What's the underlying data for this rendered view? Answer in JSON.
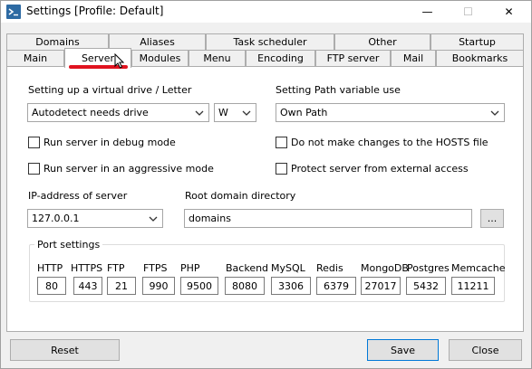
{
  "window": {
    "title": "Settings [Profile: Default]",
    "controls": {
      "minimize": "—",
      "maximize": "☐",
      "close": "✕"
    }
  },
  "tabs": {
    "row1": [
      "Domains",
      "Aliases",
      "Task scheduler",
      "Other",
      "Startup"
    ],
    "row2": [
      "Main",
      "Server",
      "Modules",
      "Menu",
      "Encoding",
      "FTP server",
      "Mail",
      "Bookmarks"
    ],
    "active": "Server"
  },
  "server": {
    "drive_label": "Setting up a virtual drive / Letter",
    "drive_mode": "Autodetect needs drive",
    "drive_letter": "W",
    "path_label": "Setting Path variable use",
    "path_mode": "Own Path",
    "checks": {
      "debug": "Run server in debug mode",
      "aggressive": "Run server in an aggressive mode",
      "hosts": "Do not make changes to the HOSTS file",
      "protect": "Protect server from external access"
    },
    "ip_label": "IP-address of server",
    "ip_value": "127.0.0.1",
    "root_label": "Root domain directory",
    "root_value": "domains",
    "browse_label": "...",
    "ports_title": "Port settings",
    "ports": [
      {
        "label": "HTTP",
        "value": "80"
      },
      {
        "label": "HTTPS",
        "value": "443"
      },
      {
        "label": "FTP",
        "value": "21"
      },
      {
        "label": "FTPS",
        "value": "990"
      },
      {
        "label": "PHP",
        "value": "9500"
      },
      {
        "label": "Backend",
        "value": "8080"
      },
      {
        "label": "MySQL",
        "value": "3306"
      },
      {
        "label": "Redis",
        "value": "6379"
      },
      {
        "label": "MongoDB",
        "value": "27017"
      },
      {
        "label": "Postgres",
        "value": "5432"
      },
      {
        "label": "Memcache",
        "value": "11211"
      }
    ]
  },
  "footer": {
    "reset": "Reset",
    "save": "Save",
    "close": "Close"
  },
  "colors": {
    "accent_underline": "#e0121f",
    "panel_bg": "#ffffff",
    "window_bg": "#f0f0f0"
  }
}
